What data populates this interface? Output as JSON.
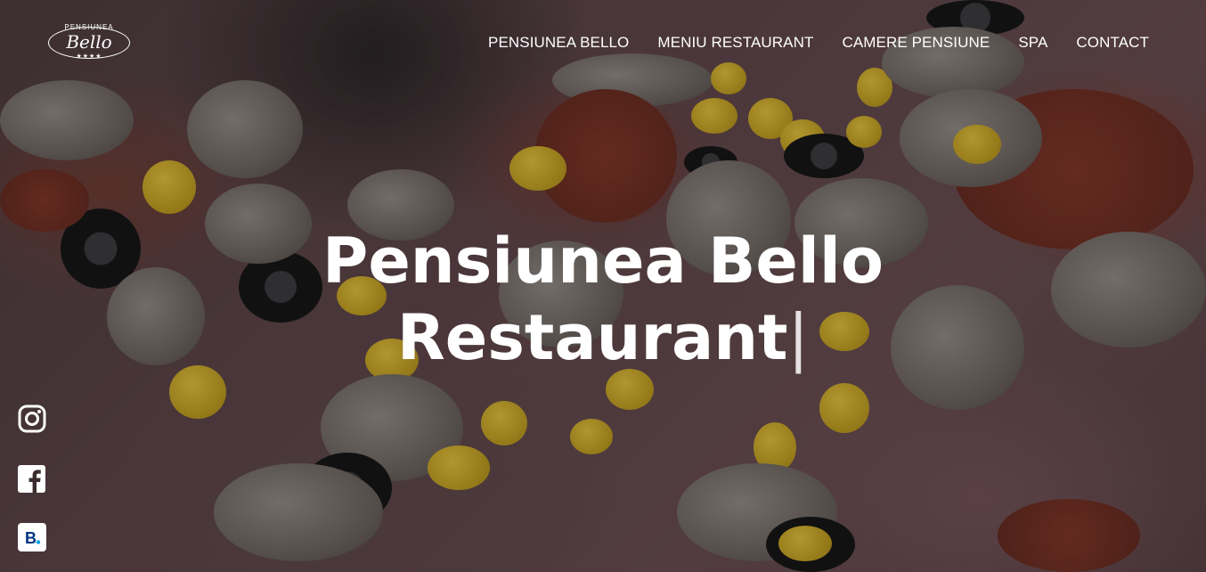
{
  "header": {
    "logo": {
      "top_text": "PENSIUNEA",
      "script_text": "Bello",
      "stars": "★★★★"
    },
    "nav": [
      {
        "label": "PENSIUNEA BELLO"
      },
      {
        "label": "MENIU RESTAURANT"
      },
      {
        "label": "CAMERE PENSIUNE"
      },
      {
        "label": "SPA"
      },
      {
        "label": "CONTACT"
      }
    ]
  },
  "hero": {
    "title_line1": "Pensiunea Bello",
    "title_line2": "Restaurant",
    "cursor": "|"
  },
  "social": [
    {
      "icon": "instagram-icon"
    },
    {
      "icon": "facebook-icon"
    },
    {
      "icon": "booking-icon",
      "label": "B."
    }
  ],
  "colors": {
    "text": "#ffffff",
    "booking_blue": "#003580",
    "booking_dot": "#00a1e4"
  }
}
